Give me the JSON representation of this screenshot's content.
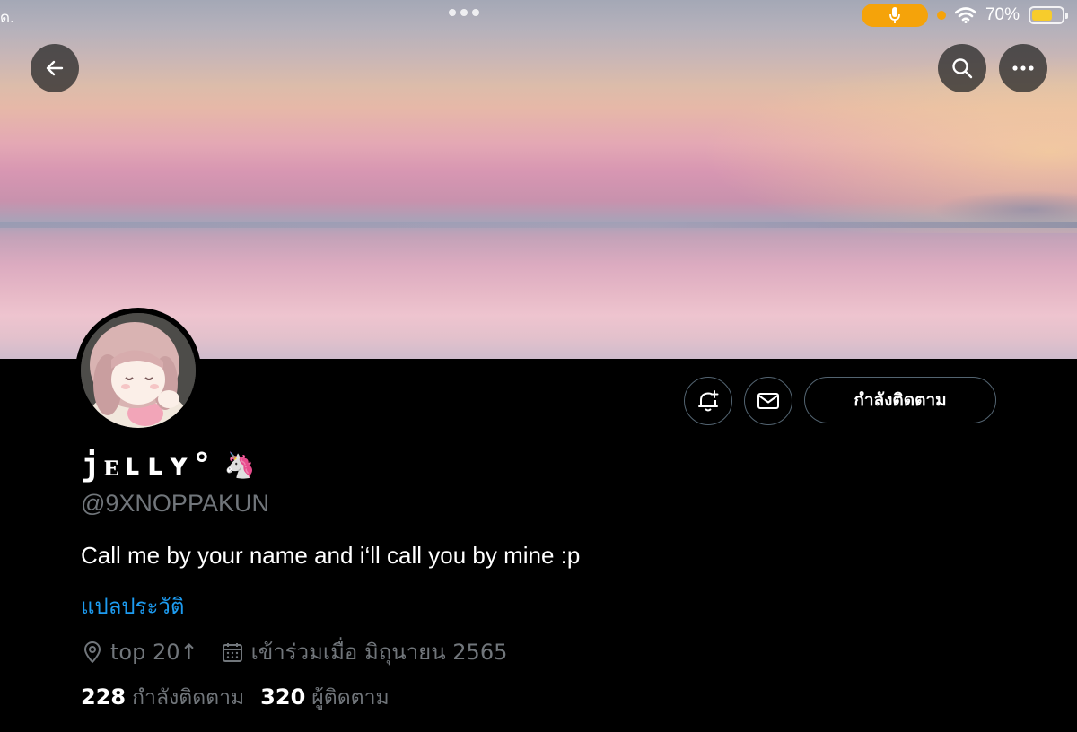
{
  "status_bar": {
    "left_text": "ด.",
    "battery_percent": "70%",
    "battery_level": 0.7,
    "mic_color": "#f5a30a"
  },
  "nav": {
    "back_icon": "arrow-left-icon",
    "search_icon": "search-icon",
    "more_icon": "more-horizontal-icon"
  },
  "profile": {
    "display_name": "jᴇʟʟʏ°",
    "name_emoji": "🦄",
    "handle": "@9XNOPPAKUN",
    "bio": "Call me by your name and i‘ll call you by mine :p",
    "translate_bio": "แปลประวัติ",
    "location": "top 20↑",
    "joined": "เข้าร่วมเมื่อ มิถุนายน 2565",
    "following_count": "228",
    "following_label": "กำลังติดตาม",
    "followers_count": "320",
    "followers_label": "ผู้ติดตาม"
  },
  "actions": {
    "notify_icon": "bell-plus-icon",
    "message_icon": "mail-icon",
    "follow_button": "กำลังติดตาม"
  },
  "colors": {
    "link": "#1d9bf0",
    "muted": "#71767b",
    "background": "#000000"
  }
}
